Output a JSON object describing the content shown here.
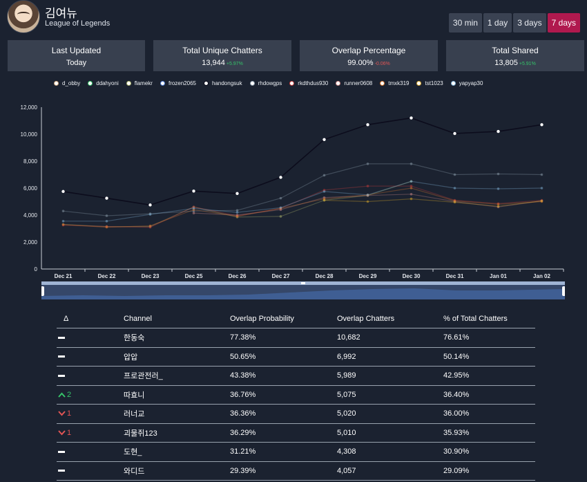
{
  "header": {
    "streamer_name": "김여뉴",
    "game": "League of Legends",
    "ranges": [
      "30 min",
      "1 day",
      "3 days",
      "7 days"
    ],
    "active_range": "7 days"
  },
  "stats": [
    {
      "label": "Last Updated",
      "value": "Today",
      "delta": ""
    },
    {
      "label": "Total Unique Chatters",
      "value": "13,944",
      "delta": "+5.97%"
    },
    {
      "label": "Overlap Percentage",
      "value": "99.00%",
      "delta": "-0.06%"
    },
    {
      "label": "Total Shared",
      "value": "13,805",
      "delta": "+5.91%"
    }
  ],
  "colors": {
    "accent": "#b0194e",
    "positive": "#36c46a",
    "negative": "#e25555"
  },
  "chart_data": {
    "type": "line",
    "categories": [
      "Dec 21",
      "Dec 22",
      "Dec 23",
      "Dec 25",
      "Dec 26",
      "Dec 27",
      "Dec 28",
      "Dec 29",
      "Dec 30",
      "Dec 31",
      "Jan 01",
      "Jan 02"
    ],
    "ylim": [
      0,
      12000
    ],
    "yticks": [
      "0",
      "2,000",
      "4,000",
      "6,000",
      "8,000",
      "10,000",
      "12,000"
    ],
    "legend_position": "top",
    "series": [
      {
        "name": "d_obby",
        "color": "#c9a27a",
        "values": [
          null,
          null,
          null,
          null,
          null,
          null,
          null,
          null,
          null,
          null,
          null,
          null
        ]
      },
      {
        "name": "ddahyoni",
        "color": "#36c46a",
        "values": [
          null,
          null,
          null,
          null,
          null,
          null,
          null,
          null,
          null,
          null,
          null,
          null
        ]
      },
      {
        "name": "flamekr",
        "color": "#a8b06a",
        "values": [
          3300,
          3150,
          3150,
          4600,
          3850,
          3900,
          5100,
          5450,
          6500,
          null,
          null,
          null
        ]
      },
      {
        "name": "frozen2065",
        "color": "#4f7bd1",
        "values": [
          null,
          null,
          null,
          null,
          null,
          null,
          null,
          null,
          null,
          null,
          null,
          null
        ]
      },
      {
        "name": "handongsuk",
        "color": "#0c0c1c",
        "values": [
          5750,
          5250,
          4750,
          5780,
          5600,
          6800,
          9600,
          10700,
          11200,
          10050,
          10200,
          10700
        ]
      },
      {
        "name": "rhdowgps",
        "color": "#8a9aa8",
        "values": [
          4300,
          3950,
          4100,
          4300,
          4350,
          5250,
          6950,
          7800,
          7800,
          7000,
          7050,
          7000
        ]
      },
      {
        "name": "rkdthdus930",
        "color": "#c23b3b",
        "values": [
          3250,
          3150,
          3100,
          4600,
          3950,
          4500,
          5850,
          6150,
          6150,
          5100,
          4850,
          5100
        ]
      },
      {
        "name": "runner0608",
        "color": "#c98686",
        "values": [
          null,
          null,
          null,
          4150,
          4000,
          4400,
          5300,
          5450,
          5550,
          5000,
          4600,
          5050
        ]
      },
      {
        "name": "tmxk319",
        "color": "#d8762d",
        "values": [
          3300,
          3100,
          3200,
          4400,
          3900,
          4500,
          5200,
          5500,
          6000,
          5050,
          4800,
          5000
        ]
      },
      {
        "name": "tst1023",
        "color": "#d7a52a",
        "values": [
          null,
          null,
          null,
          null,
          null,
          null,
          5100,
          5000,
          5200,
          4950,
          4650,
          5050
        ]
      },
      {
        "name": "yapyap30",
        "color": "#7fb0d4",
        "values": [
          3550,
          3550,
          4050,
          4500,
          4200,
          4550,
          5750,
          5500,
          6500,
          6000,
          5950,
          6000
        ]
      }
    ]
  },
  "table": {
    "headers": [
      "Δ",
      "Channel",
      "Overlap Probability",
      "Overlap Chatters",
      "% of Total Chatters"
    ],
    "rows": [
      {
        "delta_type": "none",
        "delta": "",
        "channel": "한동숙",
        "prob": "77.38%",
        "chatters": "10,682",
        "pct": "76.61%"
      },
      {
        "delta_type": "none",
        "delta": "",
        "channel": "압압",
        "prob": "50.65%",
        "chatters": "6,992",
        "pct": "50.14%"
      },
      {
        "delta_type": "none",
        "delta": "",
        "channel": "프로관전러_",
        "prob": "43.38%",
        "chatters": "5,989",
        "pct": "42.95%"
      },
      {
        "delta_type": "up",
        "delta": "2",
        "channel": "따효니",
        "prob": "36.76%",
        "chatters": "5,075",
        "pct": "36.40%"
      },
      {
        "delta_type": "down",
        "delta": "1",
        "channel": "러너교",
        "prob": "36.36%",
        "chatters": "5,020",
        "pct": "36.00%"
      },
      {
        "delta_type": "down",
        "delta": "1",
        "channel": "괴물쥐123",
        "prob": "36.29%",
        "chatters": "5,010",
        "pct": "35.93%"
      },
      {
        "delta_type": "none",
        "delta": "",
        "channel": "도현_",
        "prob": "31.21%",
        "chatters": "4,308",
        "pct": "30.90%"
      },
      {
        "delta_type": "none",
        "delta": "",
        "channel": "와디드",
        "prob": "29.39%",
        "chatters": "4,057",
        "pct": "29.09%"
      }
    ]
  }
}
